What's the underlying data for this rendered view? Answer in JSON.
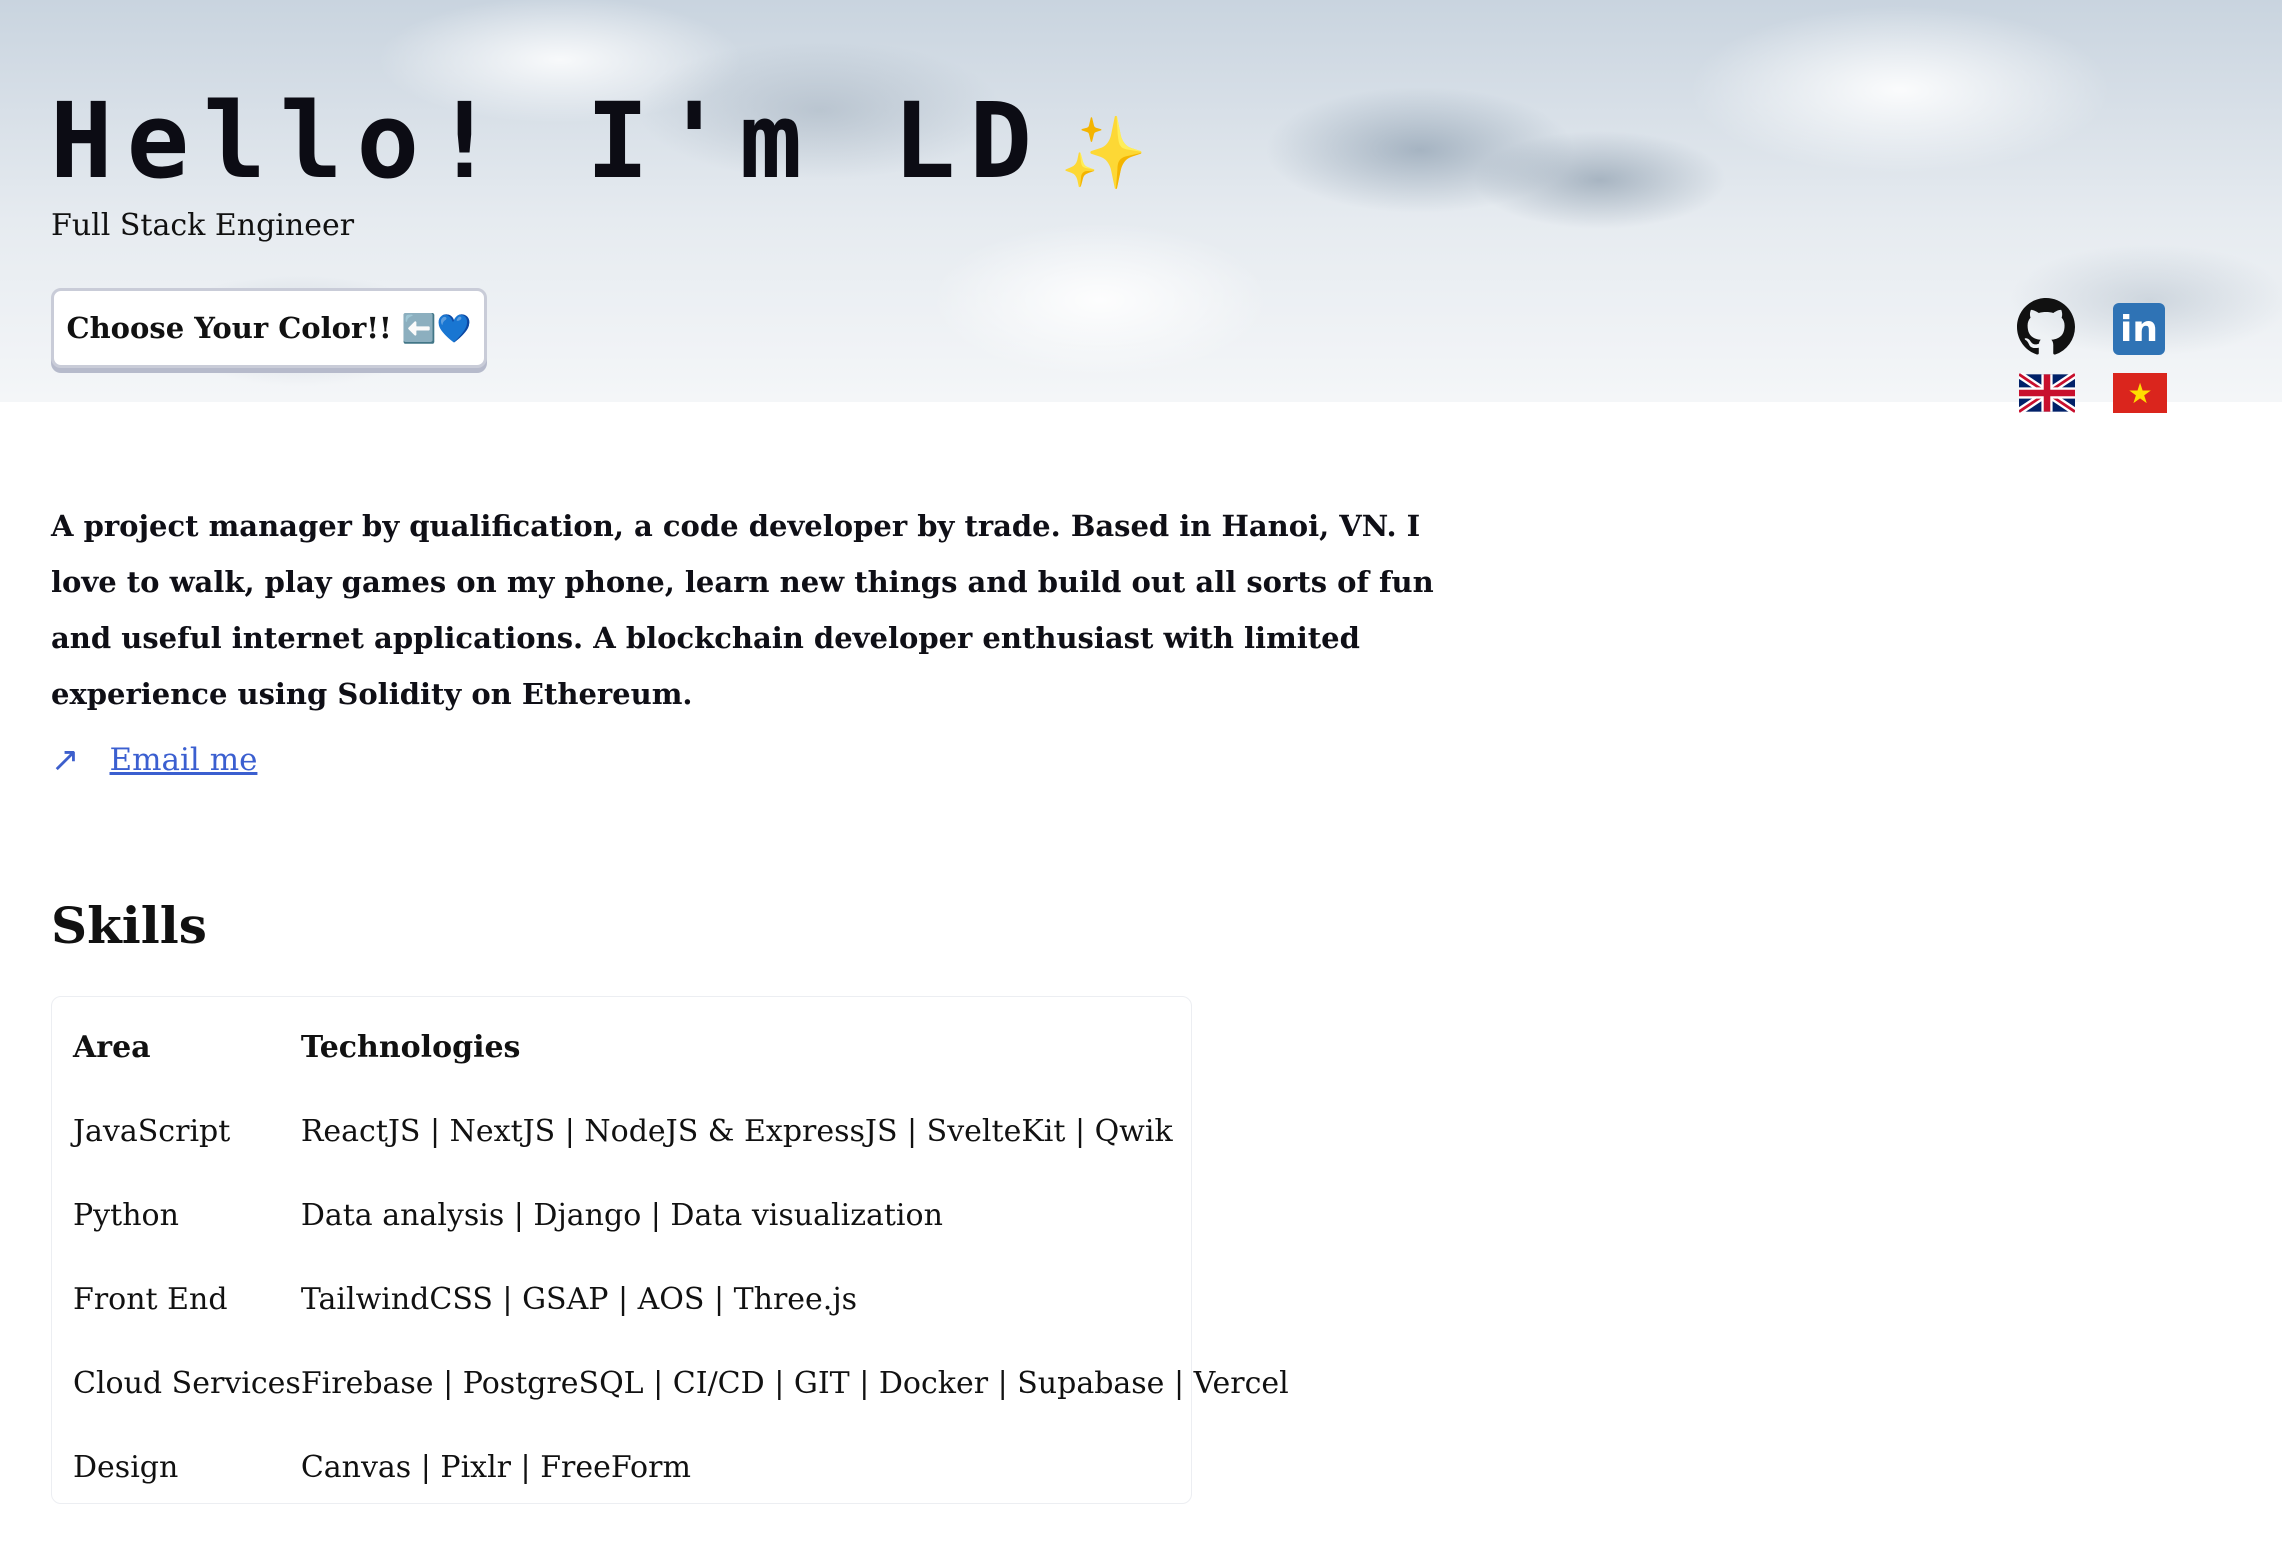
{
  "hero": {
    "title": "Hello! I'm LD",
    "sparkle": "✨",
    "subtitle": "Full Stack Engineer",
    "color_button": {
      "label": "Choose Your Color!!",
      "emoji": "⬅️💙"
    },
    "social": {
      "linkedin_text": "in"
    },
    "flags": {
      "vn_star": "★"
    }
  },
  "intro": "A project manager by qualification, a code developer by trade. Based in Hanoi, VN. I love to walk, play games on my phone, learn new things and build out all sorts of fun and useful internet applications. A blockchain developer enthusiast with limited experience using Solidity on Ethereum.",
  "email": {
    "arrow": "↗",
    "label": "Email me"
  },
  "skills": {
    "title": "Skills",
    "headers": {
      "area": "Area",
      "tech": "Technologies"
    },
    "rows": [
      {
        "area": "JavaScript",
        "tech": "ReactJS | NextJS | NodeJS & ExpressJS | SvelteKit | Qwik"
      },
      {
        "area": "Python",
        "tech": "Data analysis | Django | Data visualization"
      },
      {
        "area": "Front End",
        "tech": "TailwindCSS | GSAP | AOS | Three.js"
      },
      {
        "area": "Cloud Services",
        "tech": "Firebase | PostgreSQL | CI/CD | GIT | Docker | Supabase | Vercel"
      },
      {
        "area": "Design",
        "tech": "Canvas | Pixlr | FreeForm"
      }
    ]
  },
  "colors": {
    "link": "#3b5fd0",
    "linkedin": "#2f73b5",
    "vn_red": "#da251d",
    "vn_star": "#ffdd00"
  }
}
